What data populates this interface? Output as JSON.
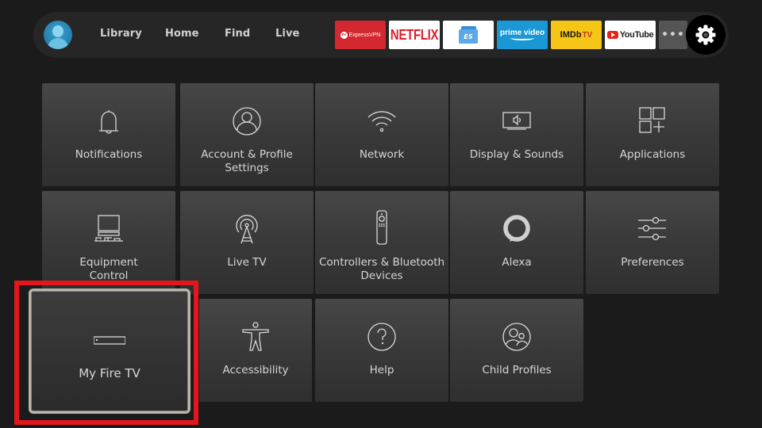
{
  "navbar": {
    "avatar_icon": "user-profile-icon",
    "links": [
      "Library",
      "Home",
      "Find",
      "Live"
    ],
    "apps": [
      {
        "name": "ExpressVPN",
        "label": "ExpressVPN",
        "badge": "ev",
        "color": "#d3282f"
      },
      {
        "name": "Netflix",
        "label": "NETFLIX",
        "color": "#db202c"
      },
      {
        "name": "ES File Explorer",
        "label": "ES",
        "color": "#5aaae8"
      },
      {
        "name": "Prime Video",
        "label": "prime video",
        "color": "#1a98d5"
      },
      {
        "name": "IMDb TV",
        "label": "IMDb",
        "label_suffix": "TV",
        "color": "#f5c518"
      },
      {
        "name": "YouTube",
        "label": "YouTube",
        "color": "#e62117"
      }
    ],
    "more_label": "•••",
    "settings_icon": "gear-icon"
  },
  "settings_tiles": [
    {
      "label": "Notifications",
      "icon": "bell-icon"
    },
    {
      "label": "Account & Profile Settings",
      "icon": "account-circle-icon"
    },
    {
      "label": "Network",
      "icon": "wifi-icon"
    },
    {
      "label": "Display & Sounds",
      "icon": "display-speaker-icon"
    },
    {
      "label": "Applications",
      "icon": "apps-grid-plus-icon"
    },
    {
      "label": "Equipment Control",
      "icon": "tv-equipment-icon"
    },
    {
      "label": "Live TV",
      "icon": "antenna-icon"
    },
    {
      "label": "Controllers & Bluetooth Devices",
      "icon": "remote-control-icon"
    },
    {
      "label": "Alexa",
      "icon": "alexa-ring-icon"
    },
    {
      "label": "Preferences",
      "icon": "sliders-icon"
    },
    {
      "label": "My Fire TV",
      "icon": "fire-tv-device-icon",
      "focused": true
    },
    {
      "label": "Accessibility",
      "icon": "accessibility-person-icon"
    },
    {
      "label": "Help",
      "icon": "help-circle-icon"
    },
    {
      "label": "Child Profiles",
      "icon": "child-profiles-icon"
    }
  ],
  "annotation": {
    "highlight_color": "#e3161d",
    "target": "My Fire TV"
  }
}
